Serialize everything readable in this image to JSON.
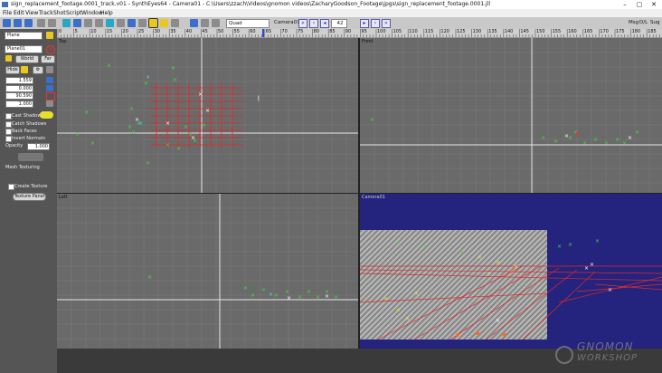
{
  "window": {
    "title": "sign_replacement_footage.0001_track.v01 - SynthEyes64 - Camera01 - C:\\Users\\zzach\\Videos\\gnomon videos\\ZacharyGoodson_Footage\\jpgs\\sign_replacement_footage.0001.jll",
    "min": "–",
    "max": "▢",
    "close": "✕"
  },
  "menu": [
    "File",
    "Edit",
    "View",
    "Track",
    "Shot",
    "Script",
    "Window",
    "Help"
  ],
  "toolbar": {
    "view_mode": "Quad",
    "camera": "Camera01",
    "frame": "42",
    "right_labels": [
      "Msg",
      "D/L",
      "Sug"
    ]
  },
  "ruler": {
    "ticks": [
      "0",
      "5",
      "10",
      "15",
      "20",
      "25",
      "30",
      "35",
      "40",
      "45",
      "50",
      "55",
      "60",
      "65",
      "70",
      "75",
      "80",
      "85",
      "90",
      "95",
      "100",
      "105",
      "110",
      "115",
      "120",
      "125",
      "130",
      "135",
      "140",
      "145",
      "150",
      "155",
      "160",
      "165",
      "170",
      "175",
      "180",
      "185"
    ]
  },
  "panel": {
    "object_type": "Plane",
    "object_name": "Plane01",
    "world_btn": "World",
    "far_btn": "Far",
    "hide_btn": "Hide",
    "field1": "1.559",
    "field2": "0.000",
    "field3": "90.590",
    "field4": "1.000",
    "cast_shadow": "Cast Shadow",
    "catch_shadows": "Catch Shadows",
    "back_faces": "Back Faces",
    "invert_normals": "Invert Normals",
    "opacity_label": "Opacity",
    "opacity_value": "1.000",
    "mesh_texturing": "Mesh Texturing",
    "create_texture": "Create Texture",
    "texture_panel": "Texture Panel"
  },
  "viewports": {
    "top": "Top",
    "front": "Front",
    "left": "Left",
    "camera": "Camera01"
  },
  "watermark": {
    "line1": "GNOMON",
    "line2": "WORKSHOP"
  },
  "colors": {
    "accent": "#3b6fc9",
    "viewport_bg": "#6a6a6a",
    "camera_bg": "#24237e",
    "marker_green": "#35e535",
    "marker_white": "#ffffff",
    "mesh_red": "#e02a2a"
  }
}
